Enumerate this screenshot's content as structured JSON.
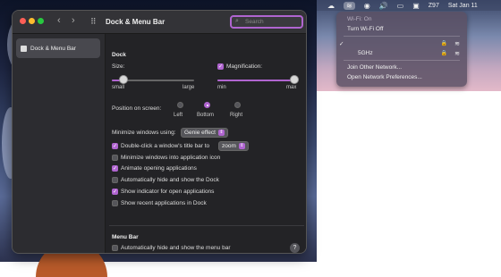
{
  "menubar": {
    "items": [
      "",
      "",
      "",
      "",
      "",
      "Z97",
      "Sat Jan 11"
    ]
  },
  "wifi_menu": {
    "status": "Wi-Fi: On",
    "turn_off": "Turn Wi-Fi Off",
    "networks": [
      {
        "name": "",
        "selected": true,
        "locked": true
      },
      {
        "name": "5GHz",
        "selected": false,
        "locked": true
      }
    ],
    "join_other": "Join Other Network...",
    "open_prefs": "Open Network Preferences..."
  },
  "window": {
    "title": "Dock & Menu Bar",
    "search_placeholder": "Search"
  },
  "sidebar": {
    "items": [
      {
        "label": "Dock & Menu Bar",
        "selected": true
      }
    ]
  },
  "dock": {
    "heading": "Dock",
    "size_label": "Size:",
    "size_min": "small",
    "size_max": "large",
    "size_value": 0.14,
    "magnification_label": "Magnification:",
    "magnification_checked": true,
    "mag_min": "min",
    "mag_max": "max",
    "magnification_value": 1.0,
    "position_label": "Position on screen:",
    "positions": [
      "Left",
      "Bottom",
      "Right"
    ],
    "position_selected": "Bottom",
    "minimize_label": "Minimize windows using:",
    "minimize_value": "Genie effect",
    "double_click_label": "Double-click a window's title bar to",
    "double_click_value": "zoom",
    "double_click_checked": true,
    "options": [
      {
        "label": "Minimize windows into application icon",
        "checked": false
      },
      {
        "label": "Animate opening applications",
        "checked": true
      },
      {
        "label": "Automatically hide and show the Dock",
        "checked": false
      },
      {
        "label": "Show indicator for open applications",
        "checked": true
      },
      {
        "label": "Show recent applications in Dock",
        "checked": false
      }
    ]
  },
  "menu_bar_section": {
    "heading": "Menu Bar",
    "autohide_label": "Automatically hide and show the menu bar",
    "autohide_checked": false
  },
  "help_glyph": "?",
  "colors": {
    "accent": "#b065d0",
    "window_bg": "#2a2a2e"
  }
}
